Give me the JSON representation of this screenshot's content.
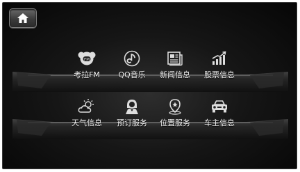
{
  "home": {
    "icon": "home-icon"
  },
  "apps_row1": [
    {
      "label": "考拉FM",
      "icon": "koala-fm-icon"
    },
    {
      "label": "QQ音乐",
      "icon": "qq-music-icon"
    },
    {
      "label": "新闻信息",
      "icon": "news-icon"
    },
    {
      "label": "股票信息",
      "icon": "stock-chart-icon"
    }
  ],
  "apps_row2": [
    {
      "label": "天气信息",
      "icon": "weather-icon"
    },
    {
      "label": "预订服务",
      "icon": "reservation-service-icon"
    },
    {
      "label": "位置服务",
      "icon": "location-pin-icon"
    },
    {
      "label": "车主信息",
      "icon": "car-icon"
    }
  ]
}
